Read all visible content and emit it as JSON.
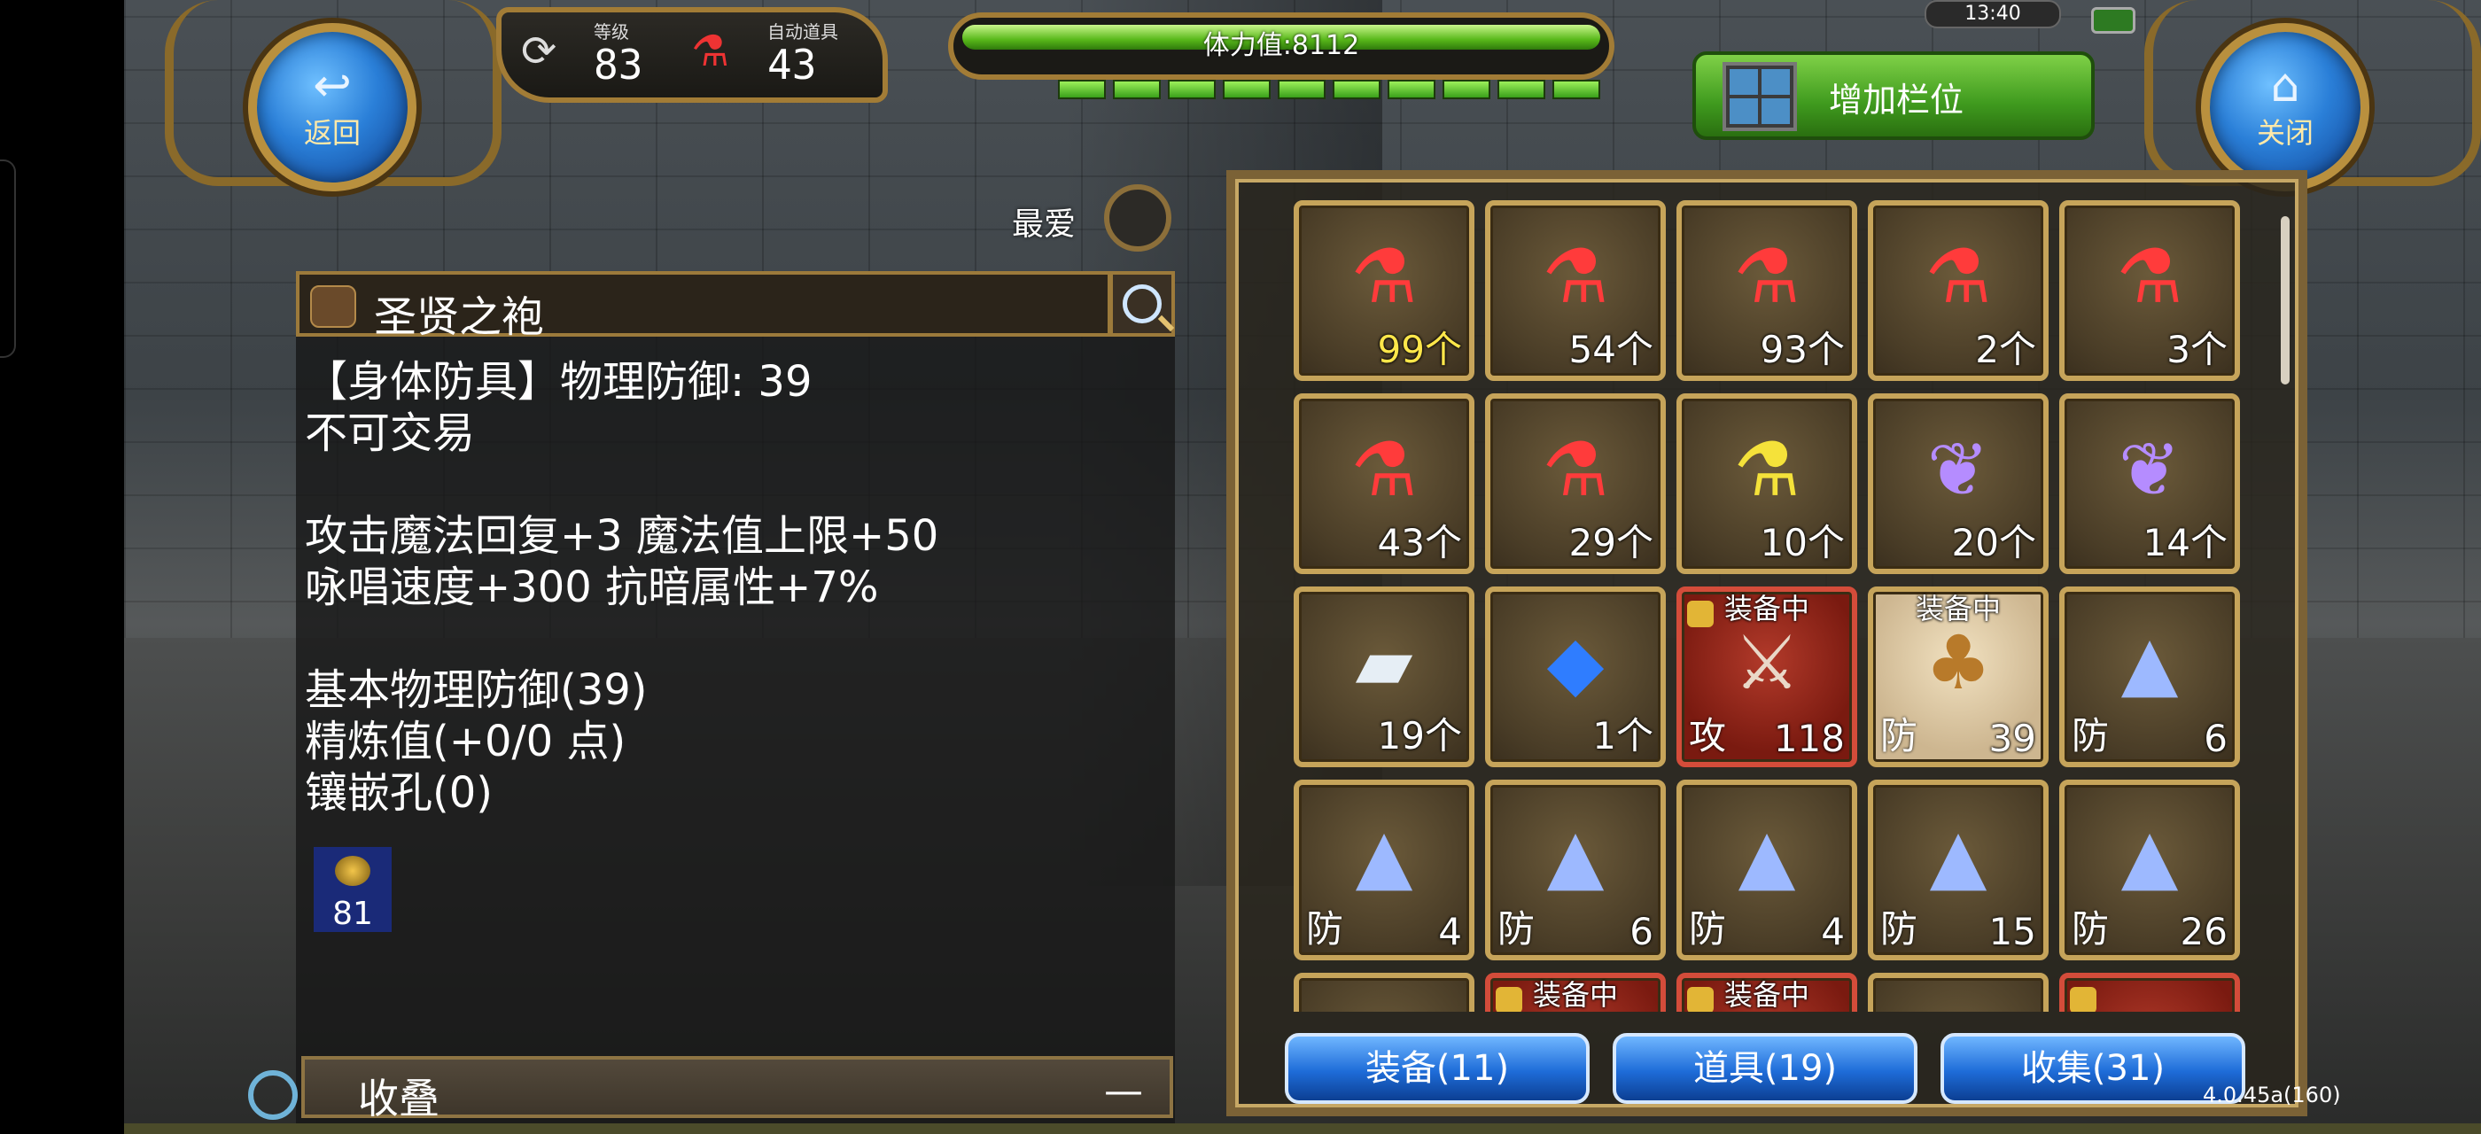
{
  "hud": {
    "back_label": "返回",
    "close_label": "关闭",
    "level_caption": "等级",
    "level_value": "83",
    "auto_item_caption": "自动道具",
    "auto_item_value": "43",
    "stamina_text": "体力值:8112",
    "add_slot_label": "增加栏位",
    "clock": "13:40"
  },
  "favorite": {
    "label": "最爱"
  },
  "detail": {
    "name": "圣贤之袍",
    "lines": [
      "【身体防具】物理防御: 39",
      "不可交易",
      "",
      "攻击魔法回复+3 魔法值上限+50",
      "咏唱速度+300 抗暗属性+7%",
      "",
      "基本物理防御(39)",
      "精炼值(+0/0 点)",
      "镶嵌孔(0)"
    ],
    "gem_count": "81",
    "collapse_label": "收叠",
    "collapse_symbol": "—"
  },
  "inventory": {
    "equipped_label": "装备中",
    "rows": [
      [
        {
          "icon": "red-potion",
          "count": "99个",
          "highlight": true
        },
        {
          "icon": "red-potion",
          "count": "54个"
        },
        {
          "icon": "red-potion",
          "count": "93个"
        },
        {
          "icon": "red-potion",
          "count": "2个"
        },
        {
          "icon": "red-potion",
          "count": "3个"
        }
      ],
      [
        {
          "icon": "red-potion",
          "count": "43个"
        },
        {
          "icon": "red-potion",
          "count": "29个"
        },
        {
          "icon": "yellow-potion",
          "count": "10个"
        },
        {
          "icon": "feather-wing",
          "count": "20个"
        },
        {
          "icon": "feather-wing",
          "count": "14个"
        }
      ],
      [
        {
          "icon": "metal-ingot",
          "count": "19个"
        },
        {
          "icon": "blue-crystal",
          "count": "1个"
        },
        {
          "icon": "sword",
          "type": "攻",
          "count": "118",
          "equipped": true,
          "locked": true,
          "style": "red"
        },
        {
          "icon": "robe",
          "type": "防",
          "count": "39",
          "equipped": true,
          "style": "sel"
        },
        {
          "icon": "wizard-hat",
          "type": "防",
          "count": "6"
        }
      ],
      [
        {
          "icon": "wizard-hat",
          "type": "防",
          "count": "4"
        },
        {
          "icon": "wizard-hat",
          "type": "防",
          "count": "6"
        },
        {
          "icon": "wizard-hat",
          "type": "防",
          "count": "4"
        },
        {
          "icon": "wizard-hat",
          "type": "防",
          "count": "15"
        },
        {
          "icon": "wizard-hat",
          "type": "防",
          "count": "26"
        }
      ],
      [
        {
          "icon": "partial"
        },
        {
          "icon": "partial",
          "equipped": true,
          "locked": true,
          "style": "red"
        },
        {
          "icon": "partial",
          "equipped": true,
          "locked": true,
          "style": "red"
        },
        {
          "icon": "partial"
        },
        {
          "icon": "partial",
          "locked": true,
          "style": "red"
        }
      ]
    ]
  },
  "tabs": [
    {
      "label": "装备(11)"
    },
    {
      "label": "道具(19)"
    },
    {
      "label": "收集(31)"
    }
  ],
  "version": "4.0.45a(160)"
}
